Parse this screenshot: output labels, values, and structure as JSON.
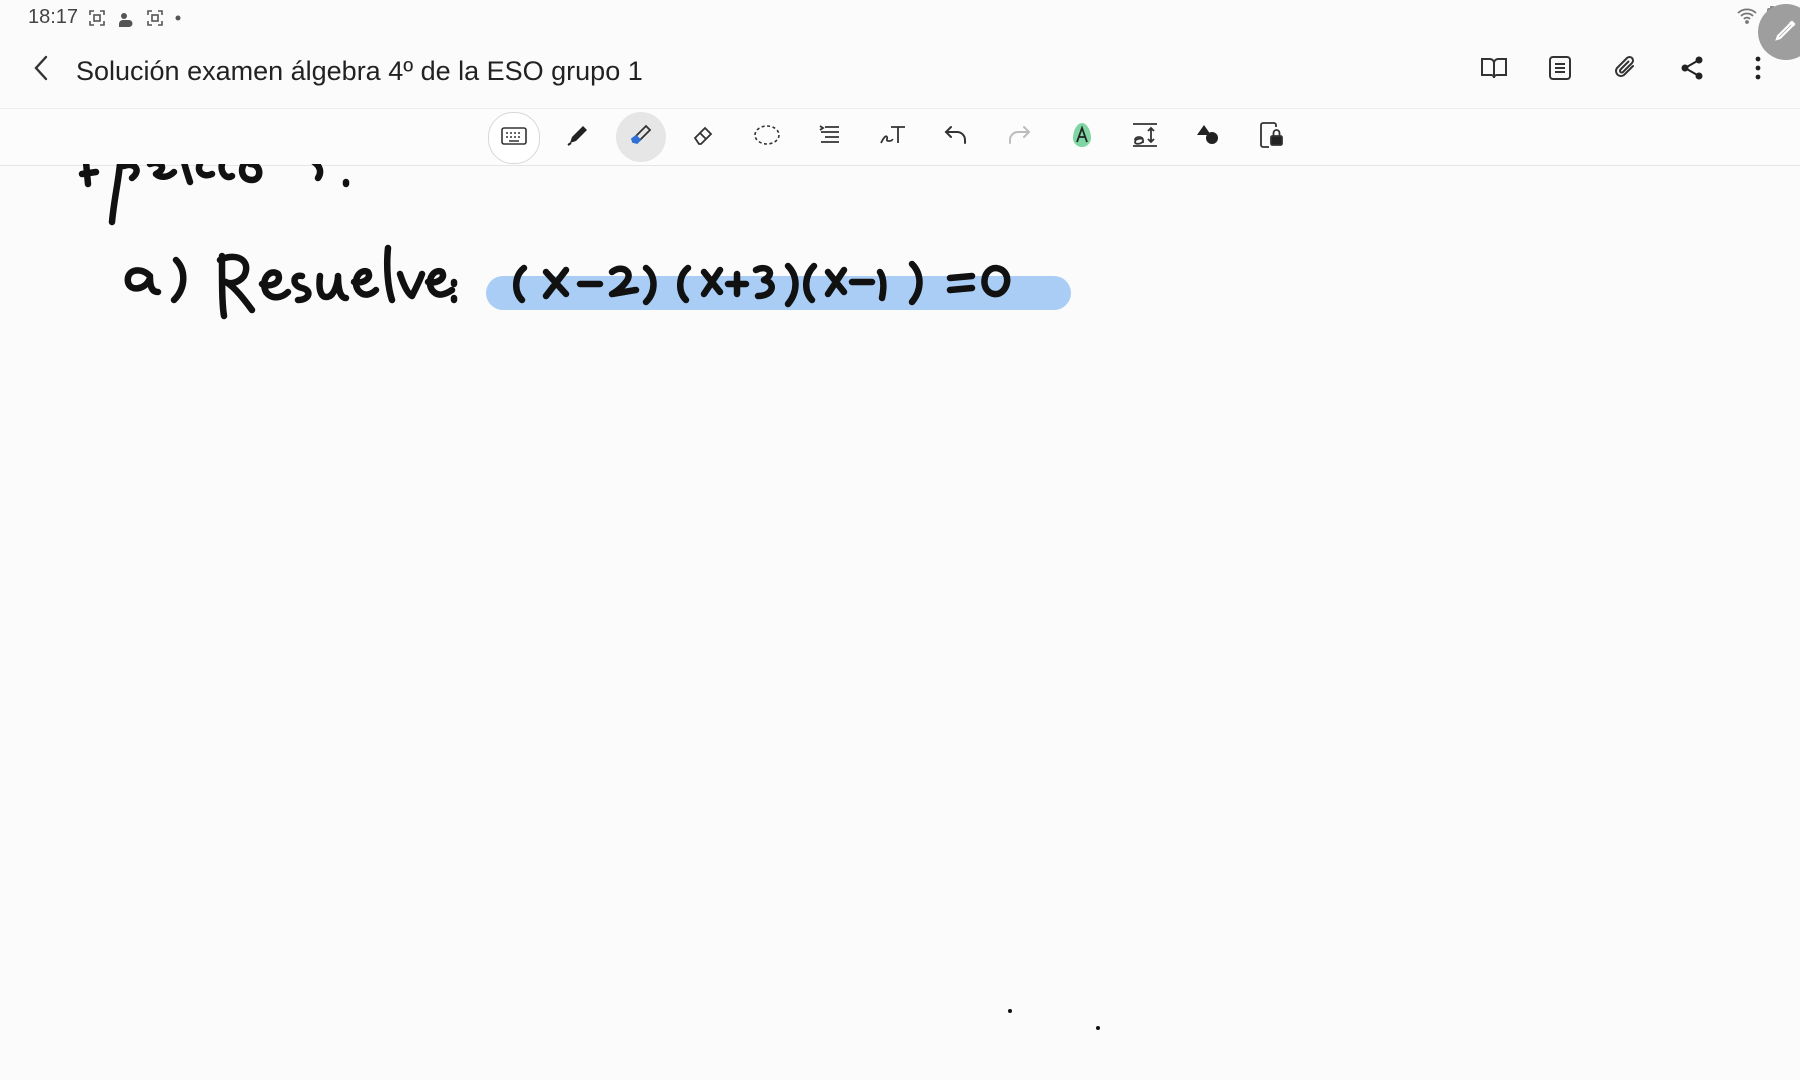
{
  "status_bar": {
    "time": "18:17",
    "left_icons": [
      "screenshot-icon",
      "cloud-sun-icon",
      "screenshot-icon",
      "dot-icon"
    ],
    "right_icons": [
      "wifi-icon",
      "battery-icon"
    ]
  },
  "header": {
    "title": "Solución examen álgebra 4º de la ESO grupo 1",
    "actions": [
      "book-view-icon",
      "page-list-icon",
      "attachment-icon",
      "share-icon",
      "more-options-icon"
    ]
  },
  "toolbar": {
    "tools": [
      {
        "name": "keyboard",
        "icon": "keyboard-icon"
      },
      {
        "name": "pen",
        "icon": "pen-icon"
      },
      {
        "name": "highlighter",
        "icon": "highlighter-icon",
        "active": true
      },
      {
        "name": "eraser",
        "icon": "eraser-icon"
      },
      {
        "name": "lasso",
        "icon": "lasso-icon"
      },
      {
        "name": "text-format",
        "icon": "text-align-icon"
      },
      {
        "name": "handwriting-to-text",
        "icon": "handwriting-text-icon"
      },
      {
        "name": "undo",
        "icon": "undo-icon"
      },
      {
        "name": "redo",
        "icon": "redo-icon"
      },
      {
        "name": "text-color",
        "icon": "text-color-icon"
      },
      {
        "name": "text-size",
        "icon": "text-size-icon"
      },
      {
        "name": "shapes",
        "icon": "shapes-icon"
      },
      {
        "name": "read-only-lock",
        "icon": "lock-page-icon"
      }
    ]
  },
  "canvas": {
    "content_type": "handwritten",
    "highlight_color": "#a9cdf5",
    "ink_color": "#111111"
  }
}
